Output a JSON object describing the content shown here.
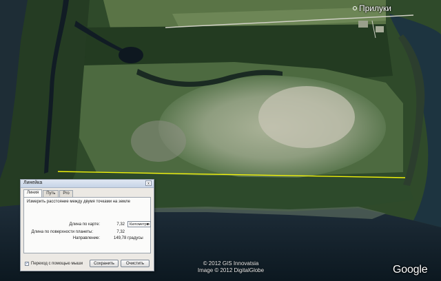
{
  "map": {
    "place_label": "Прилуки",
    "credit_line1": "© 2012 GIS Innovatsia",
    "credit_line2": "Image © 2012 DigitalGlobe",
    "google_logo": "Google",
    "ruler_line_color": "#f2f20a"
  },
  "dialog": {
    "title": "Линейка",
    "close_label": "x",
    "tabs": [
      {
        "label": "Линия",
        "active": true
      },
      {
        "label": "Путь",
        "active": false
      },
      {
        "label": "Pro",
        "active": false
      }
    ],
    "instruction": "Измерить расстояние между двумя точками на земле",
    "map_length_label": "Длина по карте:",
    "map_length_value": "7,32",
    "units_value": "Километры",
    "ground_length_label": "Длина по поверхности планеты:",
    "ground_length_value": "7,32",
    "heading_label": "Направление:",
    "heading_value": "149,78 градусы",
    "mouse_nav_label": "Переход с помощью мыши",
    "mouse_nav_checked": true,
    "save_label": "Сохранить",
    "clear_label": "Очистить"
  }
}
